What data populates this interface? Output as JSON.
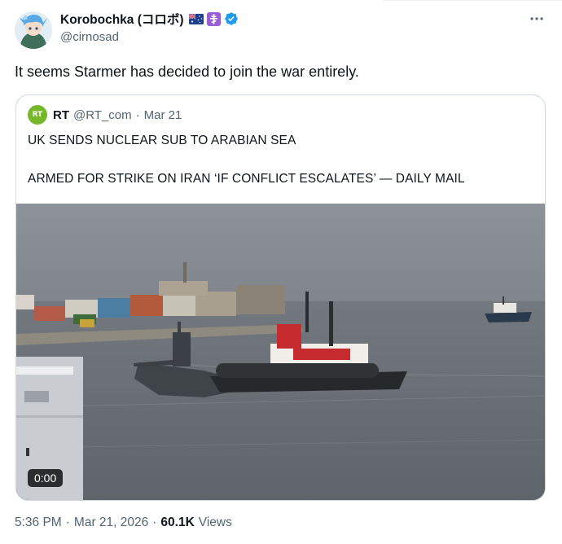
{
  "author": {
    "display_name": "Korobochka (コロボ)",
    "handle": "@cirnosad"
  },
  "icons": {
    "avatar": "anime-avatar-icon",
    "flag": "australia-flag-icon",
    "cross": "orthodox-cross-icon",
    "verified": "verified-badge-icon",
    "more": "more-options-icon"
  },
  "colors": {
    "verified": "#1d9bf0",
    "rt_green": "#76b82a",
    "secondary_text": "#536471",
    "cross_bg": "#9b5dd4"
  },
  "tweet": {
    "text": "It seems Starmer has decided to join the war entirely."
  },
  "quote": {
    "logo_text": "RT",
    "name": "RT",
    "handle": "@RT_com",
    "separator": "·",
    "date": "Mar 21",
    "line1": "UK SENDS NUCLEAR SUB TO ARABIAN SEA",
    "line2": "ARMED FOR STRIKE ON IRAN ‘IF CONFLICT ESCALATES’ — DAILY MAIL",
    "video_time": "0:00"
  },
  "meta": {
    "time": "5:36 PM",
    "sep1": "·",
    "date": "Mar 21, 2026",
    "sep2": "·",
    "views_count": "60.1K",
    "views_label": "Views"
  }
}
